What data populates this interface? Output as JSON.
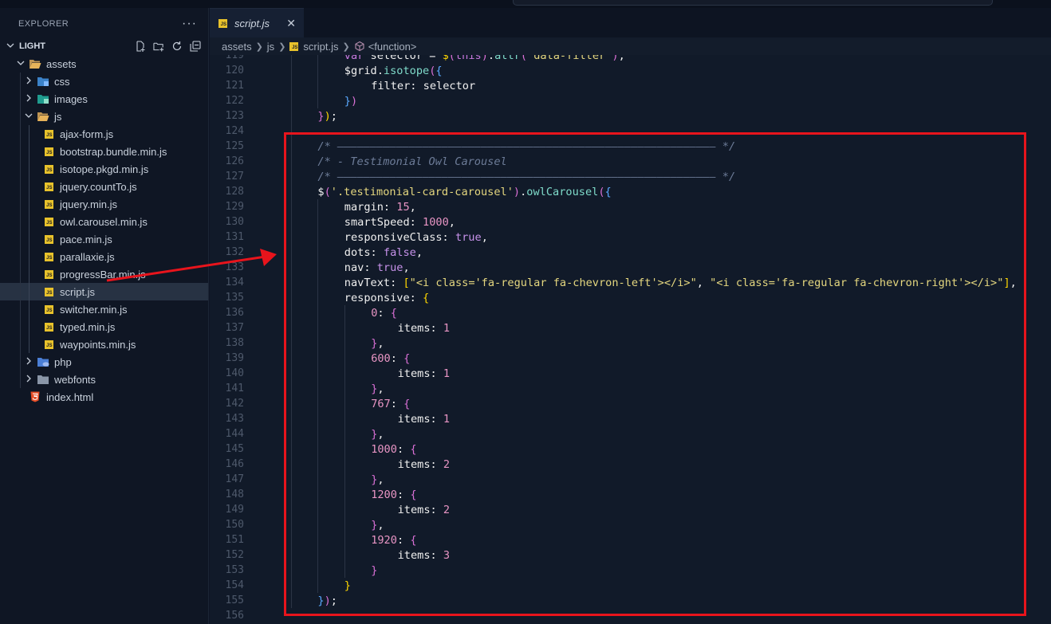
{
  "explorer": {
    "title": "EXPLORER",
    "more": "···",
    "root": "LIGHT",
    "tree": [
      {
        "label": "assets",
        "depth": 1,
        "type": "folder-open",
        "chevron": "down"
      },
      {
        "label": "css",
        "depth": 2,
        "type": "folder-css",
        "chevron": "right"
      },
      {
        "label": "images",
        "depth": 2,
        "type": "folder-images",
        "chevron": "right"
      },
      {
        "label": "js",
        "depth": 2,
        "type": "folder-open",
        "chevron": "down"
      },
      {
        "label": "ajax-form.js",
        "depth": 3,
        "type": "js"
      },
      {
        "label": "bootstrap.bundle.min.js",
        "depth": 3,
        "type": "js"
      },
      {
        "label": "isotope.pkgd.min.js",
        "depth": 3,
        "type": "js"
      },
      {
        "label": "jquery.countTo.js",
        "depth": 3,
        "type": "js"
      },
      {
        "label": "jquery.min.js",
        "depth": 3,
        "type": "js"
      },
      {
        "label": "owl.carousel.min.js",
        "depth": 3,
        "type": "js"
      },
      {
        "label": "pace.min.js",
        "depth": 3,
        "type": "js"
      },
      {
        "label": "parallaxie.js",
        "depth": 3,
        "type": "js"
      },
      {
        "label": "progressBar.min.js",
        "depth": 3,
        "type": "js"
      },
      {
        "label": "script.js",
        "depth": 3,
        "type": "js",
        "selected": true
      },
      {
        "label": "switcher.min.js",
        "depth": 3,
        "type": "js"
      },
      {
        "label": "typed.min.js",
        "depth": 3,
        "type": "js"
      },
      {
        "label": "waypoints.min.js",
        "depth": 3,
        "type": "js"
      },
      {
        "label": "php",
        "depth": 2,
        "type": "folder-php",
        "chevron": "right"
      },
      {
        "label": "webfonts",
        "depth": 2,
        "type": "folder",
        "chevron": "right"
      },
      {
        "label": "index.html",
        "depth": 1,
        "type": "html"
      }
    ]
  },
  "editor": {
    "tab": {
      "label": "script.js",
      "close": "✕"
    },
    "breadcrumb": [
      "assets",
      "js",
      "script.js",
      "<function>"
    ],
    "lines": [
      {
        "n": "119",
        "indent": 2,
        "tokens": [
          [
            "kw",
            "var"
          ],
          [
            "v",
            " selector = "
          ],
          [
            "brk1",
            "$"
          ],
          [
            "brk2",
            "("
          ],
          [
            "kw",
            "this"
          ],
          [
            "brk2",
            ")"
          ],
          [
            "v",
            "."
          ],
          [
            "fn",
            "attr"
          ],
          [
            "brk2",
            "("
          ],
          [
            "str",
            "'data-filter'"
          ],
          [
            "brk2",
            ")"
          ],
          [
            "v",
            ";"
          ]
        ]
      },
      {
        "n": "120",
        "indent": 2,
        "tokens": [
          [
            "v",
            "$grid."
          ],
          [
            "fn",
            "isotope"
          ],
          [
            "brk2",
            "("
          ],
          [
            "brk3",
            "{"
          ]
        ]
      },
      {
        "n": "121",
        "indent": 3,
        "tokens": [
          [
            "v",
            "filter: selector"
          ]
        ]
      },
      {
        "n": "122",
        "indent": 2,
        "tokens": [
          [
            "brk3",
            "}"
          ],
          [
            "brk2",
            ")"
          ]
        ]
      },
      {
        "n": "123",
        "indent": 1,
        "tokens": [
          [
            "brk2",
            "}"
          ],
          [
            "brk1",
            ")"
          ],
          [
            "v",
            ";"
          ]
        ]
      },
      {
        "n": "124",
        "indent": 0,
        "tokens": []
      },
      {
        "n": "125",
        "indent": 1,
        "tokens": [
          [
            "com",
            "/* —————————————————————————————————————————————————————————— */"
          ]
        ]
      },
      {
        "n": "126",
        "indent": 1,
        "tokens": [
          [
            "com",
            "/* - Testimonial Owl Carousel"
          ]
        ]
      },
      {
        "n": "127",
        "indent": 1,
        "tokens": [
          [
            "com",
            "/* —————————————————————————————————————————————————————————— */"
          ]
        ]
      },
      {
        "n": "128",
        "indent": 1,
        "tokens": [
          [
            "v",
            "$"
          ],
          [
            "brk2",
            "("
          ],
          [
            "str",
            "'.testimonial-card-carousel'"
          ],
          [
            "brk2",
            ")"
          ],
          [
            "v",
            "."
          ],
          [
            "fn",
            "owlCarousel"
          ],
          [
            "brk2",
            "("
          ],
          [
            "brk3",
            "{"
          ]
        ]
      },
      {
        "n": "129",
        "indent": 2,
        "tokens": [
          [
            "v",
            "margin: "
          ],
          [
            "num",
            "15"
          ],
          [
            "v",
            ","
          ]
        ]
      },
      {
        "n": "130",
        "indent": 2,
        "tokens": [
          [
            "v",
            "smartSpeed: "
          ],
          [
            "num",
            "1000"
          ],
          [
            "v",
            ","
          ]
        ]
      },
      {
        "n": "131",
        "indent": 2,
        "tokens": [
          [
            "v",
            "responsiveClass: "
          ],
          [
            "bool",
            "true"
          ],
          [
            "v",
            ","
          ]
        ]
      },
      {
        "n": "132",
        "indent": 2,
        "tokens": [
          [
            "v",
            "dots: "
          ],
          [
            "bool",
            "false"
          ],
          [
            "v",
            ","
          ]
        ]
      },
      {
        "n": "133",
        "indent": 2,
        "tokens": [
          [
            "v",
            "nav: "
          ],
          [
            "bool",
            "true"
          ],
          [
            "v",
            ","
          ]
        ]
      },
      {
        "n": "134",
        "indent": 2,
        "tokens": [
          [
            "v",
            "navText: "
          ],
          [
            "brk1",
            "["
          ],
          [
            "str",
            "\"<i class='fa-regular fa-chevron-left'></i>\""
          ],
          [
            "v",
            ", "
          ],
          [
            "str",
            "\"<i class='fa-regular fa-chevron-right'></i>\""
          ],
          [
            "brk1",
            "]"
          ],
          [
            "v",
            ","
          ]
        ]
      },
      {
        "n": "135",
        "indent": 2,
        "tokens": [
          [
            "v",
            "responsive: "
          ],
          [
            "brk1",
            "{"
          ]
        ]
      },
      {
        "n": "136",
        "indent": 3,
        "tokens": [
          [
            "num",
            "0"
          ],
          [
            "v",
            ": "
          ],
          [
            "brk2",
            "{"
          ]
        ]
      },
      {
        "n": "137",
        "indent": 4,
        "tokens": [
          [
            "v",
            "items: "
          ],
          [
            "num",
            "1"
          ]
        ]
      },
      {
        "n": "138",
        "indent": 3,
        "tokens": [
          [
            "brk2",
            "}"
          ],
          [
            "v",
            ","
          ]
        ]
      },
      {
        "n": "139",
        "indent": 3,
        "tokens": [
          [
            "num",
            "600"
          ],
          [
            "v",
            ": "
          ],
          [
            "brk2",
            "{"
          ]
        ]
      },
      {
        "n": "140",
        "indent": 4,
        "tokens": [
          [
            "v",
            "items: "
          ],
          [
            "num",
            "1"
          ]
        ]
      },
      {
        "n": "141",
        "indent": 3,
        "tokens": [
          [
            "brk2",
            "}"
          ],
          [
            "v",
            ","
          ]
        ]
      },
      {
        "n": "142",
        "indent": 3,
        "tokens": [
          [
            "num",
            "767"
          ],
          [
            "v",
            ": "
          ],
          [
            "brk2",
            "{"
          ]
        ]
      },
      {
        "n": "143",
        "indent": 4,
        "tokens": [
          [
            "v",
            "items: "
          ],
          [
            "num",
            "1"
          ]
        ]
      },
      {
        "n": "144",
        "indent": 3,
        "tokens": [
          [
            "brk2",
            "}"
          ],
          [
            "v",
            ","
          ]
        ]
      },
      {
        "n": "145",
        "indent": 3,
        "tokens": [
          [
            "num",
            "1000"
          ],
          [
            "v",
            ": "
          ],
          [
            "brk2",
            "{"
          ]
        ]
      },
      {
        "n": "146",
        "indent": 4,
        "tokens": [
          [
            "v",
            "items: "
          ],
          [
            "num",
            "2"
          ]
        ]
      },
      {
        "n": "147",
        "indent": 3,
        "tokens": [
          [
            "brk2",
            "}"
          ],
          [
            "v",
            ","
          ]
        ]
      },
      {
        "n": "148",
        "indent": 3,
        "tokens": [
          [
            "num",
            "1200"
          ],
          [
            "v",
            ": "
          ],
          [
            "brk2",
            "{"
          ]
        ]
      },
      {
        "n": "149",
        "indent": 4,
        "tokens": [
          [
            "v",
            "items: "
          ],
          [
            "num",
            "2"
          ]
        ]
      },
      {
        "n": "150",
        "indent": 3,
        "tokens": [
          [
            "brk2",
            "}"
          ],
          [
            "v",
            ","
          ]
        ]
      },
      {
        "n": "151",
        "indent": 3,
        "tokens": [
          [
            "num",
            "1920"
          ],
          [
            "v",
            ": "
          ],
          [
            "brk2",
            "{"
          ]
        ]
      },
      {
        "n": "152",
        "indent": 4,
        "tokens": [
          [
            "v",
            "items: "
          ],
          [
            "num",
            "3"
          ]
        ]
      },
      {
        "n": "153",
        "indent": 3,
        "tokens": [
          [
            "brk2",
            "}"
          ]
        ]
      },
      {
        "n": "154",
        "indent": 2,
        "tokens": [
          [
            "brk1",
            "}"
          ]
        ]
      },
      {
        "n": "155",
        "indent": 1,
        "tokens": [
          [
            "brk3",
            "}"
          ],
          [
            "brk2",
            ")"
          ],
          [
            "v",
            ";"
          ]
        ]
      },
      {
        "n": "156",
        "indent": 0,
        "tokens": []
      }
    ]
  },
  "colors": {
    "highlight": "#e8141c",
    "js_icon": "#e8c22b"
  }
}
